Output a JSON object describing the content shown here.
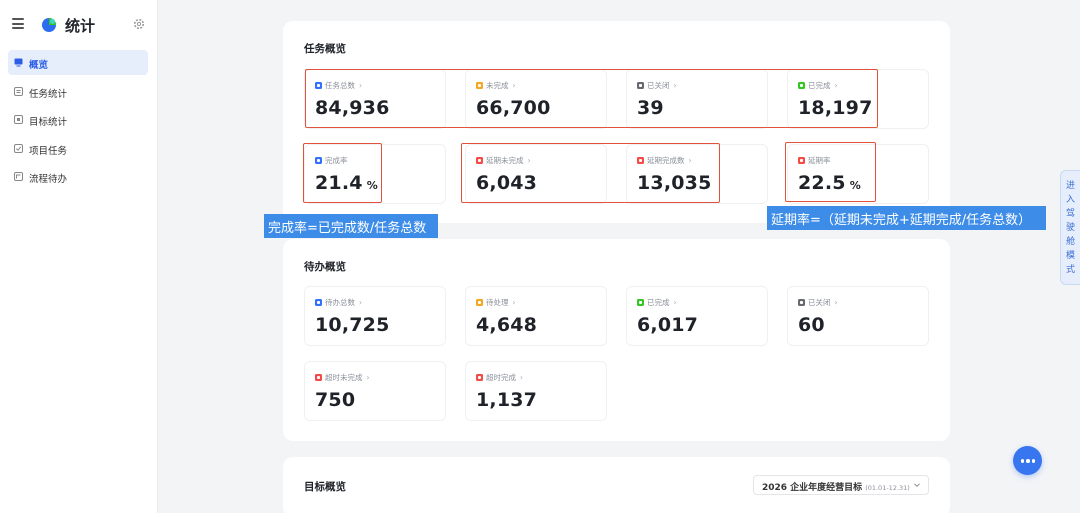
{
  "app": {
    "title": "统计"
  },
  "sidebar": {
    "items": [
      {
        "label": "概览",
        "icon": "monitor-icon",
        "active": true
      },
      {
        "label": "任务统计",
        "icon": "task-icon",
        "active": false
      },
      {
        "label": "目标统计",
        "icon": "target-icon",
        "active": false
      },
      {
        "label": "项目任务",
        "icon": "project-icon",
        "active": false
      },
      {
        "label": "流程待办",
        "icon": "flow-icon",
        "active": false
      }
    ]
  },
  "task_overview": {
    "title": "任务概览",
    "stats": [
      {
        "label": "任务总数",
        "value": "84,936",
        "unit": "",
        "color": "#3370ff"
      },
      {
        "label": "未完成",
        "value": "66,700",
        "unit": "",
        "color": "#f5a623"
      },
      {
        "label": "已关闭",
        "value": "39",
        "unit": "",
        "color": "#666a70"
      },
      {
        "label": "已完成",
        "value": "18,197",
        "unit": "",
        "color": "#34c724"
      },
      {
        "label": "完成率",
        "value": "21.4",
        "unit": "%",
        "color": "#3370ff"
      },
      {
        "label": "延期未完成",
        "value": "6,043",
        "unit": "",
        "color": "#f54a45"
      },
      {
        "label": "延期完成数",
        "value": "13,035",
        "unit": "",
        "color": "#f54a45"
      },
      {
        "label": "延期率",
        "value": "22.5",
        "unit": "%",
        "color": "#f54a45"
      }
    ]
  },
  "annotations": {
    "completion_formula": "完成率=已完成数/任务总数",
    "delay_formula": "延期率=（延期未完成+延期完成/任务总数）"
  },
  "todo_overview": {
    "title": "待办概览",
    "stats": [
      {
        "label": "待办总数",
        "value": "10,725",
        "color": "#3370ff"
      },
      {
        "label": "待处理",
        "value": "4,648",
        "color": "#f5a623"
      },
      {
        "label": "已完成",
        "value": "6,017",
        "color": "#34c724"
      },
      {
        "label": "已关闭",
        "value": "60",
        "color": "#666a70"
      },
      {
        "label": "超时未完成",
        "value": "750",
        "color": "#f54a45"
      },
      {
        "label": "超时完成",
        "value": "1,137",
        "color": "#f54a45"
      }
    ]
  },
  "goal_overview": {
    "title": "目标概览",
    "selector": {
      "label": "2026 企业年度经营目标",
      "range": "(01.01-12.31)"
    }
  },
  "side_tab": {
    "label": "进入驾驶舱模式"
  },
  "colors": {
    "accent": "#3370ff",
    "annotation_red": "#e2533b",
    "annotation_blue": "#3d8de8"
  }
}
